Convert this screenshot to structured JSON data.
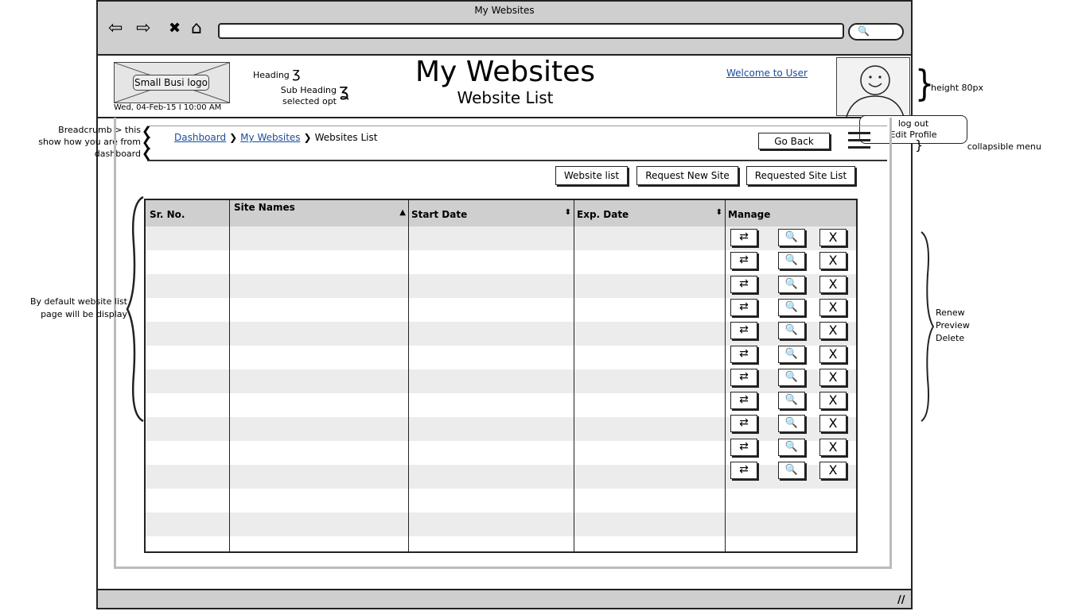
{
  "window": {
    "title": "My Websites"
  },
  "browser": {
    "nav_icons": [
      "back-arrow-icon",
      "forward-arrow-icon",
      "close-icon",
      "home-icon"
    ],
    "nav_glyphs": [
      "⇦",
      "⇨",
      "✖",
      "⌂"
    ],
    "search_glyph": "🔍"
  },
  "header": {
    "logo_text": "Small Busi logo",
    "datetime": "Wed, 04-Feb-15 I 10:00 AM",
    "heading": "My Websites",
    "subheading": "Website List",
    "welcome_link": "Welcome to User",
    "notes": {
      "heading": "Heading",
      "subheading": "Sub Heading",
      "selected_opt": "selected opt",
      "height": "height 80px"
    }
  },
  "profile_menu": {
    "items": [
      "log out",
      "Edit Profile"
    ]
  },
  "breadcrumb": {
    "items": [
      "Dashboard",
      "My Websites",
      "Websites List"
    ],
    "note_lines": [
      "Breadcrumb > this",
      "show how you are from",
      "dashboard"
    ]
  },
  "toolbar": {
    "go_back": "Go Back",
    "collapsible_note": "collapsible menu",
    "buttons": [
      "Website list",
      "Request New Site",
      "Requested Site List"
    ]
  },
  "table": {
    "columns": [
      "Sr. No.",
      "Site Names",
      "Start Date",
      "Exp. Date",
      "Manage"
    ],
    "sort_indicators": [
      "",
      "▲",
      "⬍",
      "⬍",
      ""
    ],
    "row_count": 13,
    "action_rows": 11,
    "action_glyphs": [
      "⇄",
      "🔍",
      "X"
    ]
  },
  "annotations": {
    "left": [
      "By default website list",
      "page will be display"
    ],
    "right": [
      "Renew",
      "Preview",
      "Delete"
    ]
  }
}
